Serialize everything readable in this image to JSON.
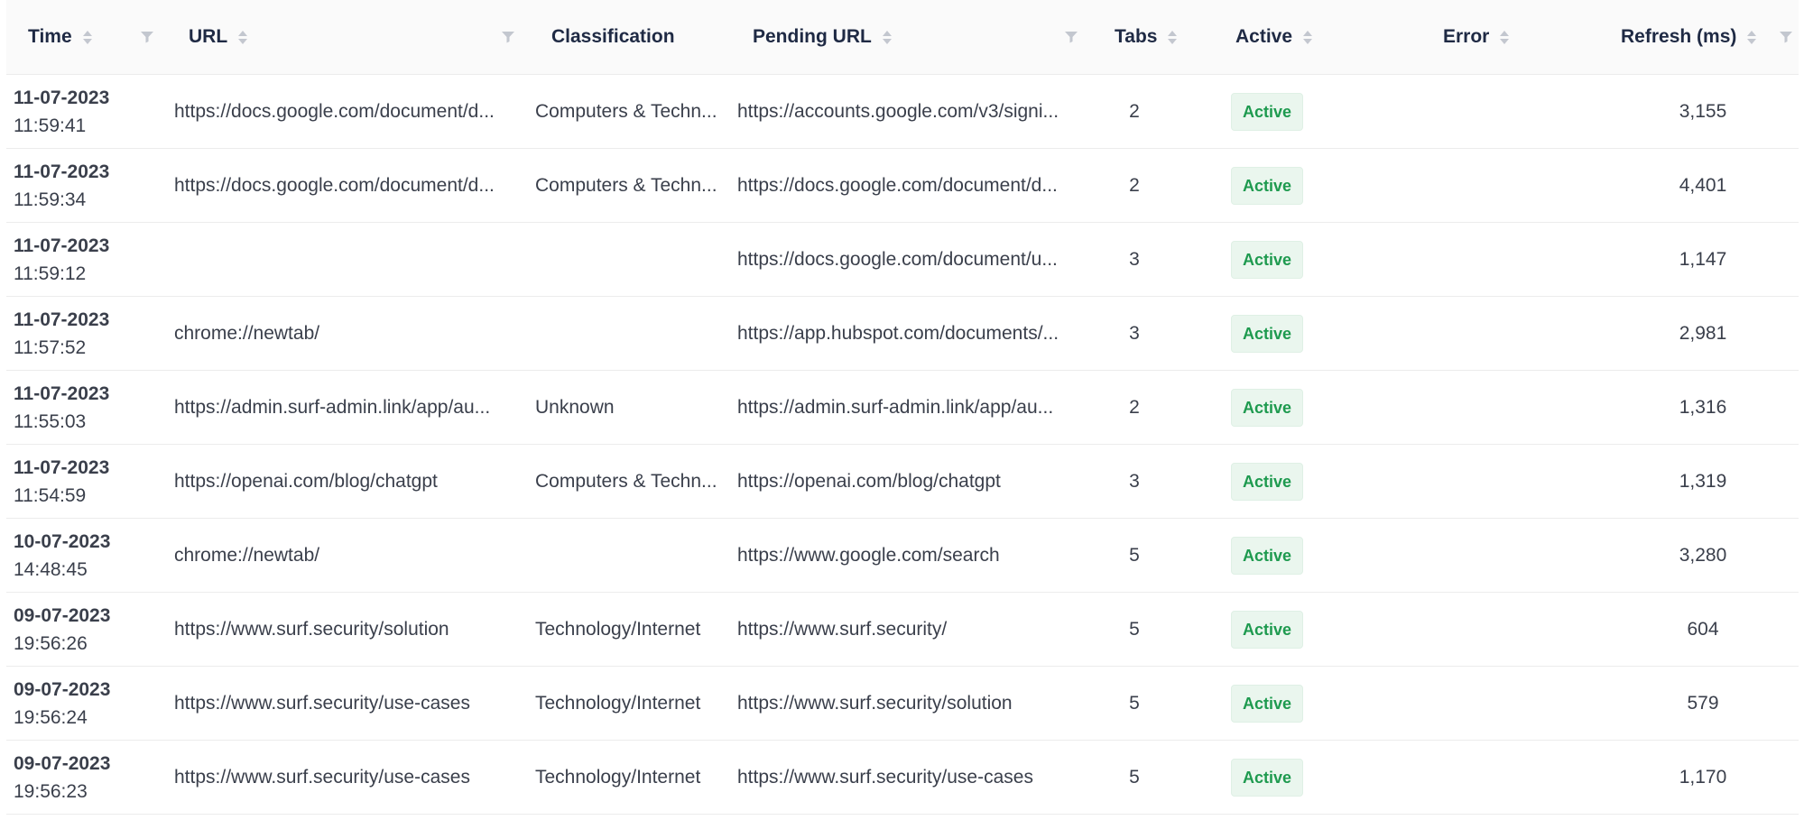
{
  "columns": {
    "time": "Time",
    "url": "URL",
    "classification": "Classification",
    "pending_url": "Pending URL",
    "tabs": "Tabs",
    "active": "Active",
    "error": "Error",
    "refresh": "Refresh (ms)"
  },
  "colors": {
    "header_text": "#1f2a44",
    "badge_bg": "#eaf6ee",
    "badge_text": "#1e9a4f"
  },
  "rows": [
    {
      "date": "11-07-2023",
      "clock": "11:59:41",
      "url": "https://docs.google.com/document/d...",
      "classification": "Computers & Techn...",
      "pending_url": "https://accounts.google.com/v3/signi...",
      "tabs": "2",
      "active": "Active",
      "error": "",
      "refresh": "3,155"
    },
    {
      "date": "11-07-2023",
      "clock": "11:59:34",
      "url": "https://docs.google.com/document/d...",
      "classification": "Computers & Techn...",
      "pending_url": "https://docs.google.com/document/d...",
      "tabs": "2",
      "active": "Active",
      "error": "",
      "refresh": "4,401"
    },
    {
      "date": "11-07-2023",
      "clock": "11:59:12",
      "url": "",
      "classification": "",
      "pending_url": "https://docs.google.com/document/u...",
      "tabs": "3",
      "active": "Active",
      "error": "",
      "refresh": "1,147"
    },
    {
      "date": "11-07-2023",
      "clock": "11:57:52",
      "url": "chrome://newtab/",
      "classification": "",
      "pending_url": "https://app.hubspot.com/documents/...",
      "tabs": "3",
      "active": "Active",
      "error": "",
      "refresh": "2,981"
    },
    {
      "date": "11-07-2023",
      "clock": "11:55:03",
      "url": "https://admin.surf-admin.link/app/au...",
      "classification": "Unknown",
      "pending_url": "https://admin.surf-admin.link/app/au...",
      "tabs": "2",
      "active": "Active",
      "error": "",
      "refresh": "1,316"
    },
    {
      "date": "11-07-2023",
      "clock": "11:54:59",
      "url": "https://openai.com/blog/chatgpt",
      "classification": "Computers & Techn...",
      "pending_url": "https://openai.com/blog/chatgpt",
      "tabs": "3",
      "active": "Active",
      "error": "",
      "refresh": "1,319"
    },
    {
      "date": "10-07-2023",
      "clock": "14:48:45",
      "url": "chrome://newtab/",
      "classification": "",
      "pending_url": "https://www.google.com/search",
      "tabs": "5",
      "active": "Active",
      "error": "",
      "refresh": "3,280"
    },
    {
      "date": "09-07-2023",
      "clock": "19:56:26",
      "url": "https://www.surf.security/solution",
      "classification": "Technology/Internet",
      "pending_url": "https://www.surf.security/",
      "tabs": "5",
      "active": "Active",
      "error": "",
      "refresh": "604"
    },
    {
      "date": "09-07-2023",
      "clock": "19:56:24",
      "url": "https://www.surf.security/use-cases",
      "classification": "Technology/Internet",
      "pending_url": "https://www.surf.security/solution",
      "tabs": "5",
      "active": "Active",
      "error": "",
      "refresh": "579"
    },
    {
      "date": "09-07-2023",
      "clock": "19:56:23",
      "url": "https://www.surf.security/use-cases",
      "classification": "Technology/Internet",
      "pending_url": "https://www.surf.security/use-cases",
      "tabs": "5",
      "active": "Active",
      "error": "",
      "refresh": "1,170"
    }
  ]
}
